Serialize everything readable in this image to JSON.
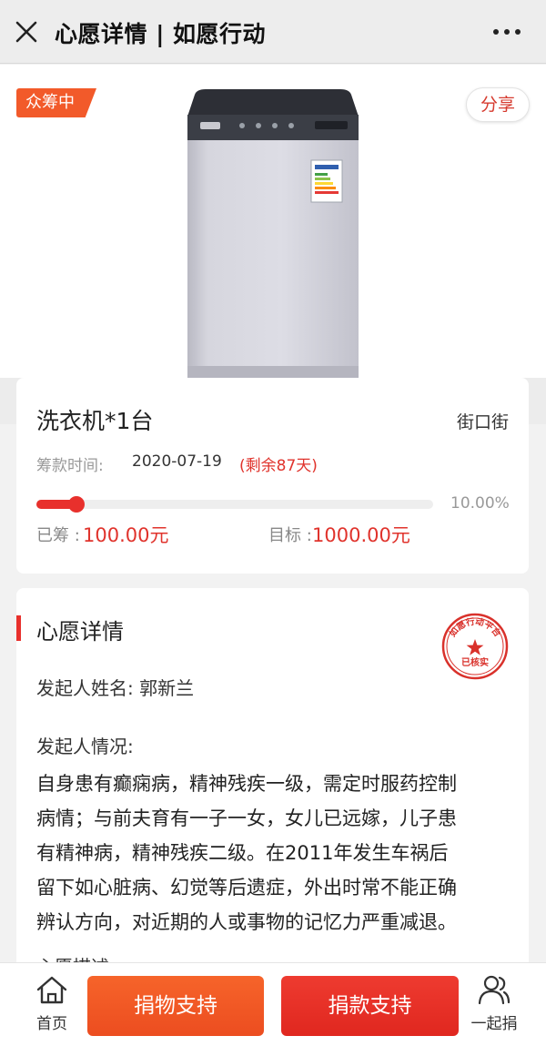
{
  "header": {
    "title": "心愿详情 | 如愿行动",
    "close_icon": "close-icon",
    "more_icon": "more-dots-icon"
  },
  "hero": {
    "badge": "众筹中",
    "share_label": "分享",
    "image": "washing-machine-image"
  },
  "project": {
    "title": "洗衣机*1台",
    "location": "街口街",
    "time_label": "筹款时间:",
    "time_value": "2020-07-19",
    "remaining": "(剩余87天)",
    "progress_text": "10.00%",
    "progress_fraction": 0.1,
    "raised_label": "已筹 :",
    "raised_value": "100.00元",
    "target_label": "目标 :",
    "target_value": "1000.00元"
  },
  "detail": {
    "section_title": "心愿详情",
    "initiator_name": "发起人姓名:  郭新兰",
    "situation_label": "发起人情况:",
    "story_lines": [
      "自身患有癫痫病，精神残疾一级，需定时服药控制",
      "病情；与前夫育有一子一女，女儿已远嫁，儿子患",
      "有精神病，精神残疾二级。在2011年发生车祸后",
      "留下如心脏病、幻觉等后遗症，外出时常不能正确",
      "辨认方向，对近期的人或事物的记忆力严重减退。"
    ],
    "next_heading": "心愿描述",
    "stamp": {
      "ring_text": "如愿行动平台",
      "center_text": "已核实",
      "color": "#d9312b"
    }
  },
  "bottom_bar": {
    "home_label": "首页",
    "donate_goods_label": "捐物支持",
    "donate_money_label": "捐款支持",
    "together_label": "一起捐"
  },
  "colors": {
    "accent_red": "#e8302c",
    "badge_orange": "#f25a2a",
    "goods_button": "#f06030",
    "money_button": "#e8302c"
  }
}
